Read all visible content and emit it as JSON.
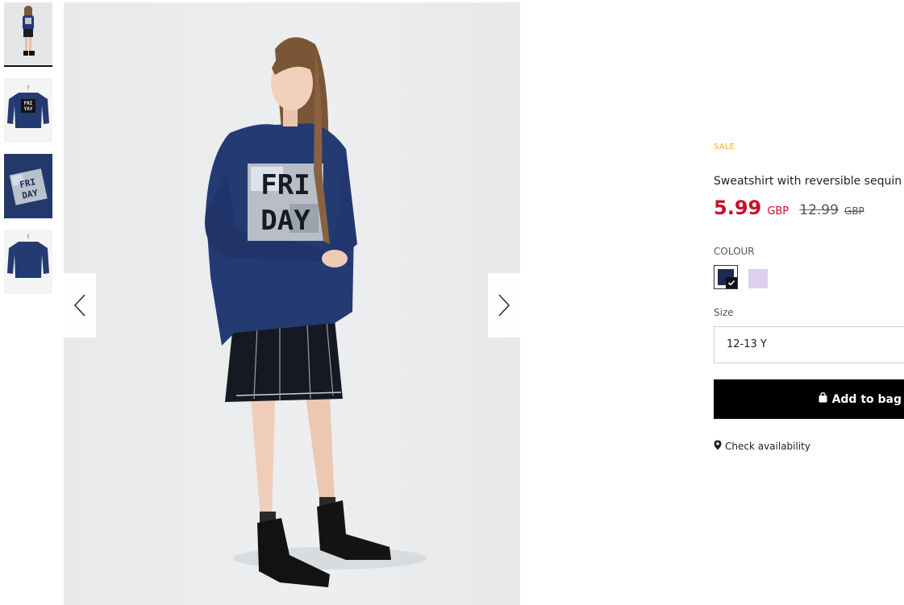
{
  "gallery": {
    "thumbnails": [
      {
        "label": "Full look view",
        "active": true
      },
      {
        "label": "Front flat view",
        "active": false
      },
      {
        "label": "Sequin detail view",
        "active": false
      },
      {
        "label": "Back flat view",
        "active": false
      }
    ],
    "prev_icon": "chevron-left-icon",
    "next_icon": "chevron-right-icon",
    "print_text": "FRI DAY",
    "thumb_print_text": "FRI YAY"
  },
  "product": {
    "sale_label": "SALE",
    "name": "Sweatshirt with reversible sequin",
    "price_now": "5.99",
    "currency_now": "GBP",
    "price_old": "12.99",
    "currency_old": "GBP",
    "colour_label": "COLOUR",
    "colours": [
      {
        "name": "navy",
        "hex": "#1c2a55",
        "selected": true
      },
      {
        "name": "lilac",
        "hex": "#ddd0ee",
        "selected": false
      }
    ],
    "size_label": "Size",
    "size_value": "12-13 Y",
    "add_button_label": "Add to bag",
    "add_button_icon": "bag-icon",
    "check_availability_label": "Check availability",
    "check_availability_icon": "location-pin-icon"
  },
  "colors": {
    "sale": "#f2b21b",
    "price_now": "#c8102e",
    "button_bg": "#000000"
  }
}
